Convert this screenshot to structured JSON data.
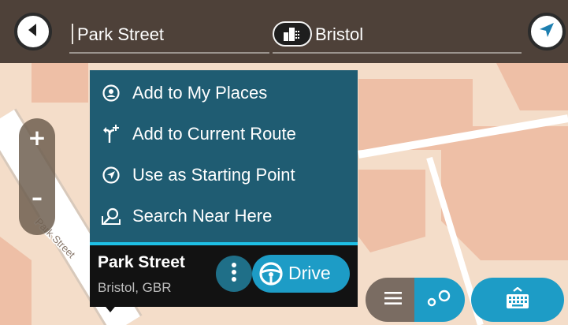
{
  "search": {
    "street_value": "Park Street",
    "city_value": "Bristol"
  },
  "map": {
    "street_label": "Park Street",
    "colors": {
      "land": "#f4ddc9",
      "building": "#eebfa6",
      "road": "#ffffff",
      "road_edge": "#d8c9bb"
    }
  },
  "zoom": {
    "in_label": "+",
    "out_label": "–"
  },
  "menu": {
    "items": [
      {
        "label": "Add to My Places",
        "icon": "my-places-icon"
      },
      {
        "label": "Add to Current Route",
        "icon": "add-route-icon"
      },
      {
        "label": "Use as Starting Point",
        "icon": "starting-point-icon"
      },
      {
        "label": "Search Near Here",
        "icon": "search-near-icon"
      }
    ]
  },
  "card": {
    "title": "Park Street",
    "subtitle": "Bristol, GBR",
    "drive_label": "Drive"
  },
  "colors": {
    "accent": "#1d9cc6",
    "menu_bg": "#1f5c72",
    "topbar_bg": "#483c34"
  }
}
